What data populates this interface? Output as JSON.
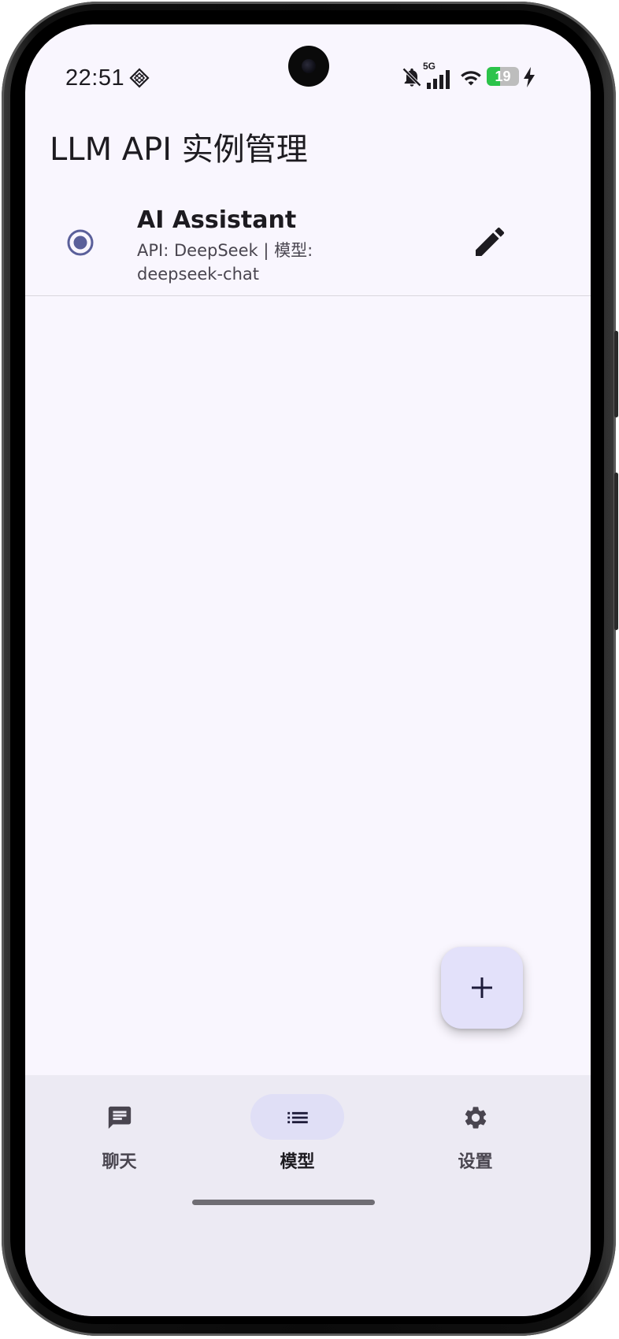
{
  "status_bar": {
    "time": "22:51",
    "network": "5G",
    "battery_level": "19",
    "battery_fraction": 0.19,
    "icons": [
      "diamond-icon",
      "bell-off-icon",
      "signal-icon",
      "wifi-icon",
      "battery-icon",
      "charging-icon"
    ]
  },
  "header": {
    "title": "LLM API 实例管理"
  },
  "instances": [
    {
      "name": "AI Assistant",
      "subtitle": "API: DeepSeek | 模型: deepseek-chat",
      "selected": true
    }
  ],
  "fab": {
    "icon": "plus-icon"
  },
  "bottom_nav": {
    "items": [
      {
        "label": "聊天",
        "icon": "chat-icon",
        "active": false
      },
      {
        "label": "模型",
        "icon": "list-icon",
        "active": true
      },
      {
        "label": "设置",
        "icon": "gear-icon",
        "active": false
      }
    ]
  },
  "colors": {
    "background": "#f9f6fe",
    "nav_background": "#eceaf3",
    "accent": "#5a5f9a",
    "fab": "#e3e1fa",
    "active_pill": "#e0dff6",
    "battery_green": "#2cc34a"
  }
}
